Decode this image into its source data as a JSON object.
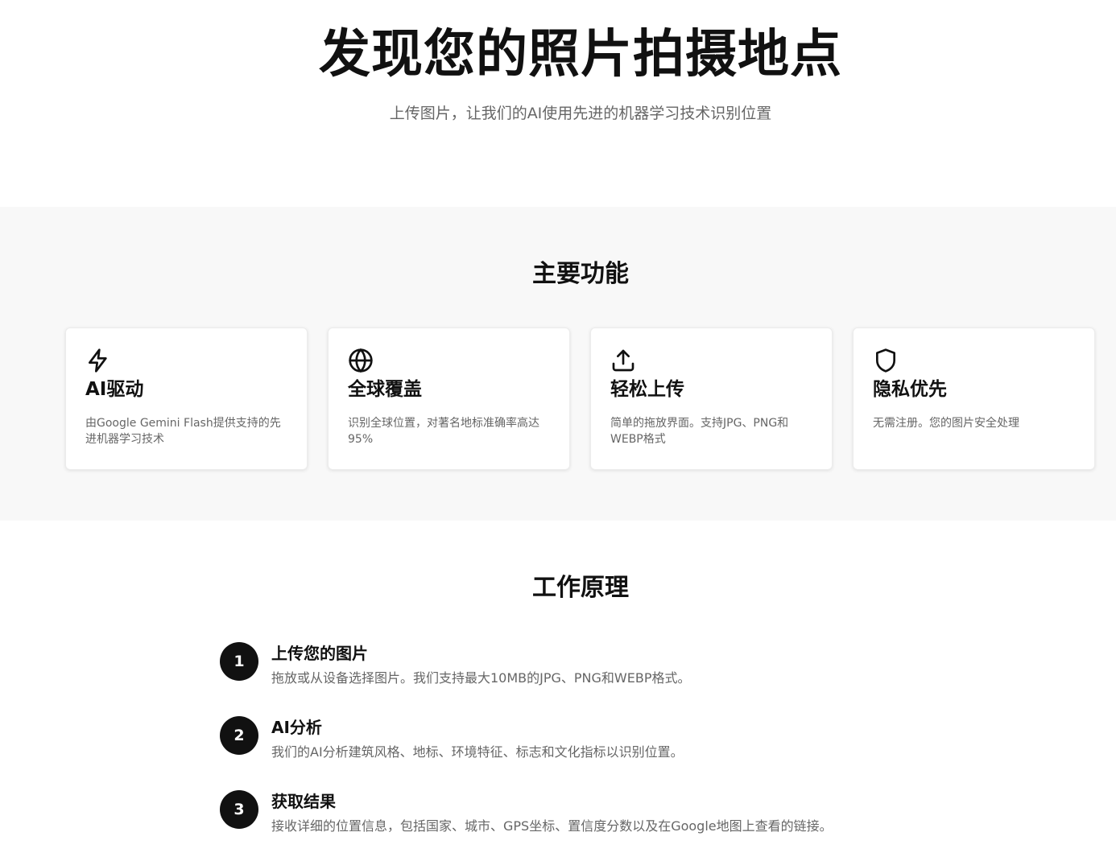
{
  "hero": {
    "title": "发现您的照片拍摄地点",
    "subtitle": "上传图片，让我们的AI使用先进的机器学习技术识别位置"
  },
  "features": {
    "title": "主要功能",
    "cards": [
      {
        "icon": "lightning-icon",
        "title": "AI驱动",
        "desc": "由Google Gemini Flash提供支持的先进机器学习技术"
      },
      {
        "icon": "globe-icon",
        "title": "全球覆盖",
        "desc": "识别全球位置，对著名地标准确率高达95%"
      },
      {
        "icon": "upload-icon",
        "title": "轻松上传",
        "desc": "简单的拖放界面。支持JPG、PNG和WEBP格式"
      },
      {
        "icon": "shield-icon",
        "title": "隐私优先",
        "desc": "无需注册。您的图片安全处理"
      }
    ]
  },
  "how": {
    "title": "工作原理",
    "steps": [
      {
        "num": "1",
        "title": "上传您的图片",
        "desc": "拖放或从设备选择图片。我们支持最大10MB的JPG、PNG和WEBP格式。"
      },
      {
        "num": "2",
        "title": "AI分析",
        "desc": "我们的AI分析建筑风格、地标、环境特征、标志和文化指标以识别位置。"
      },
      {
        "num": "3",
        "title": "获取结果",
        "desc": "接收详细的位置信息，包括国家、城市、GPS坐标、置信度分数以及在Google地图上查看的链接。"
      }
    ]
  }
}
